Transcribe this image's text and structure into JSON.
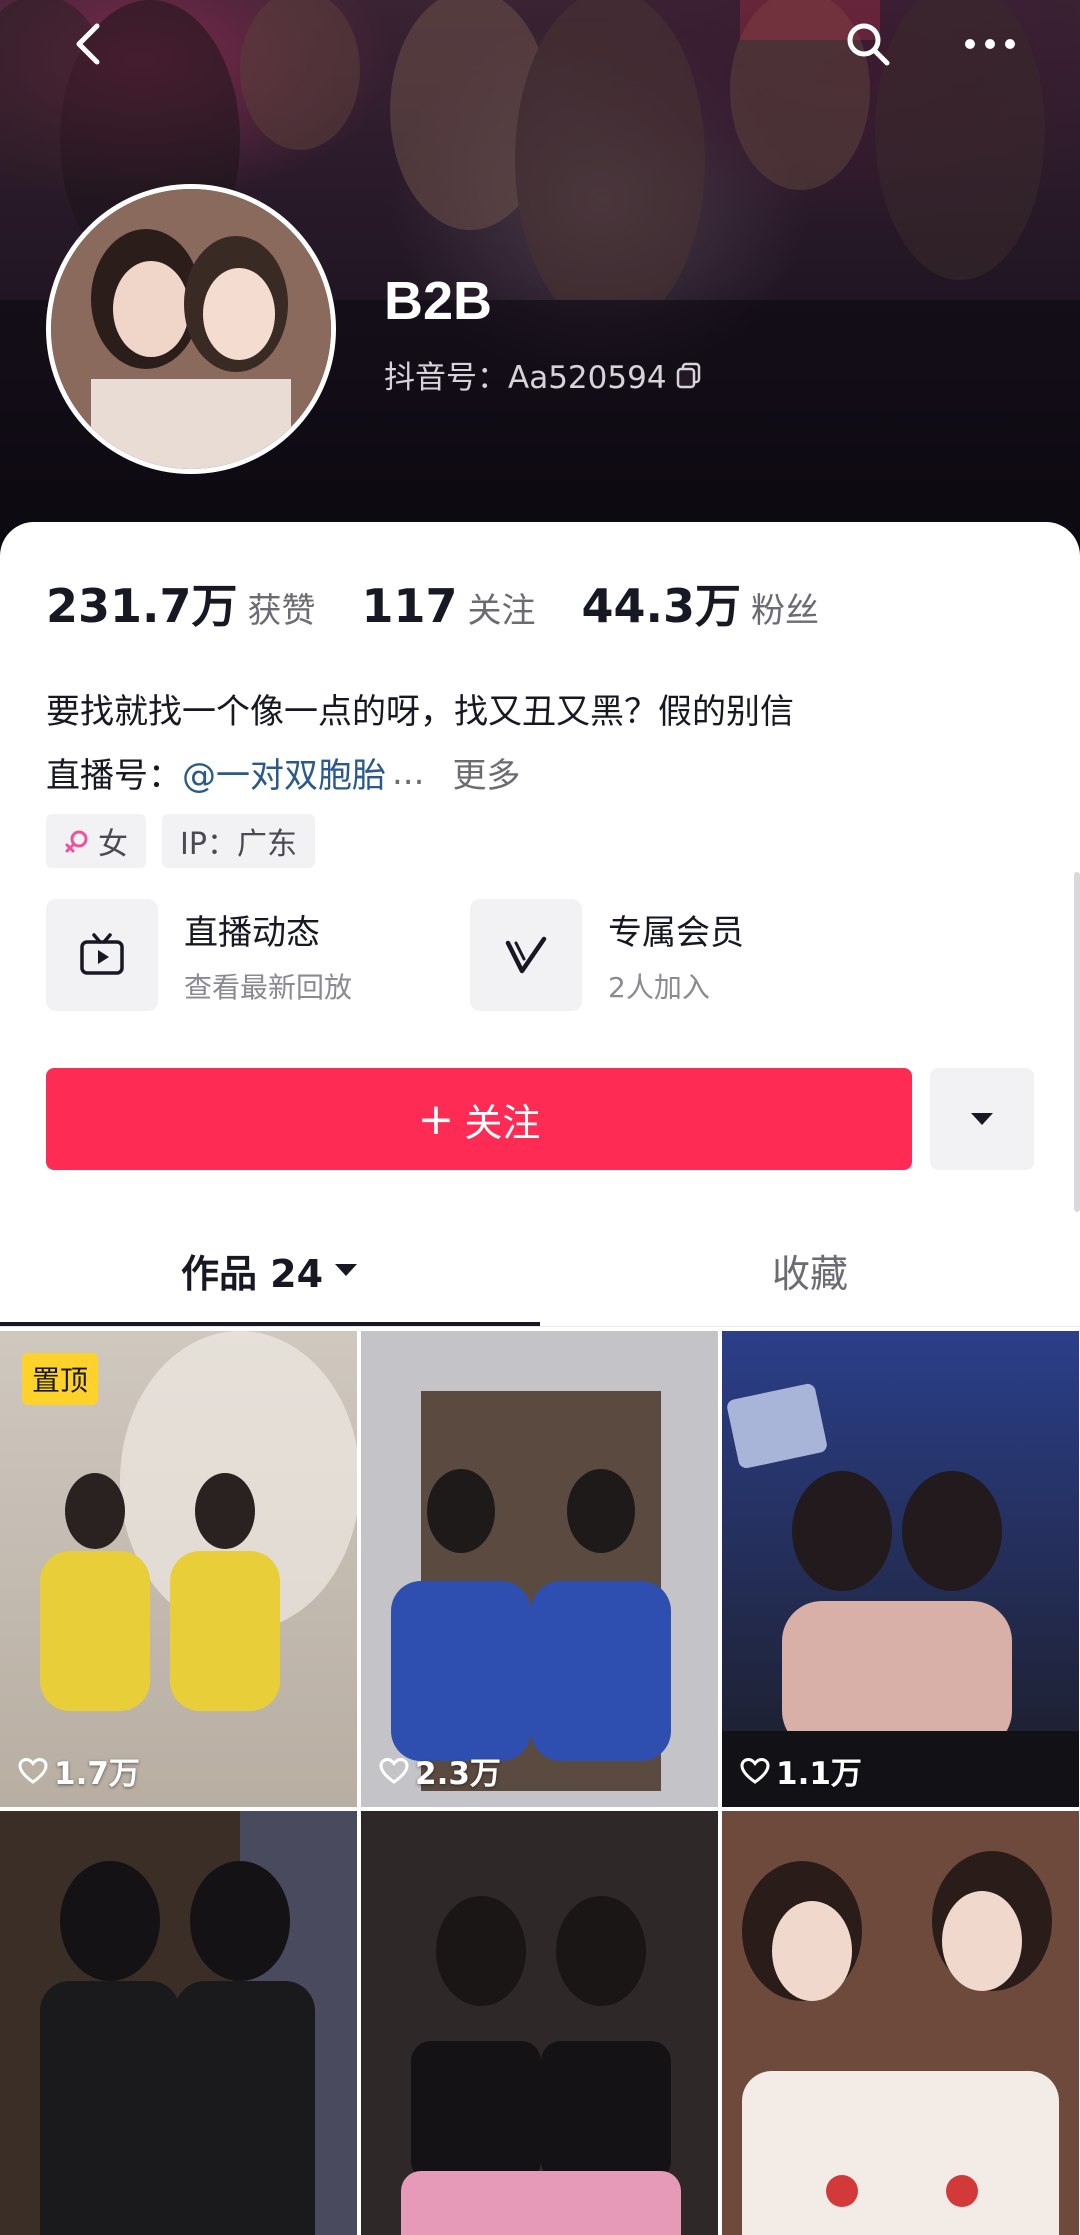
{
  "header": {
    "username": "B2B",
    "handle": "抖音号：Aa520594"
  },
  "stats": [
    {
      "value": "231.7万",
      "label": "获赞"
    },
    {
      "value": "117",
      "label": "关注"
    },
    {
      "value": "44.3万",
      "label": "粉丝"
    }
  ],
  "bio": {
    "text": "要找就找一个像一点的呀，找又丑又黑？假的别信",
    "live_prefix": "直播号：",
    "live_mention": "@一对双胞胎",
    "ellipsis": "...",
    "more": "更多"
  },
  "tags": {
    "gender": "女",
    "ip": "IP：广东"
  },
  "features": [
    {
      "title": "直播动态",
      "subtitle": "查看最新回放",
      "icon": "tv-play-icon"
    },
    {
      "title": "专属会员",
      "subtitle": "2人加入",
      "icon": "v-badge-icon"
    }
  ],
  "actions": {
    "follow": "关注"
  },
  "tabs": {
    "works": "作品 24",
    "favorites": "收藏"
  },
  "videos": [
    {
      "likes": "1.7万",
      "pinned": "置顶",
      "color_top": "#cfc8bf",
      "color_bottom": "#e7d36a"
    },
    {
      "likes": "2.3万",
      "color_top": "#c7c7ca",
      "color_bottom": "#2f4fb0"
    },
    {
      "likes": "1.1万",
      "color_top": "#2b3f8a",
      "color_bottom": "#1c1c24"
    },
    {
      "likes": "",
      "color_top": "#4a3b2e",
      "color_bottom": "#141416"
    },
    {
      "likes": "",
      "color_top": "#3c3232",
      "color_bottom": "#e79ab8"
    },
    {
      "likes": "",
      "color_top": "#6e4a3c",
      "color_bottom": "#f2ebe6"
    }
  ],
  "colors": {
    "follow_button": "#fe2c55",
    "mention": "#2a5a8a",
    "pin_badge": "#ffd22b"
  }
}
